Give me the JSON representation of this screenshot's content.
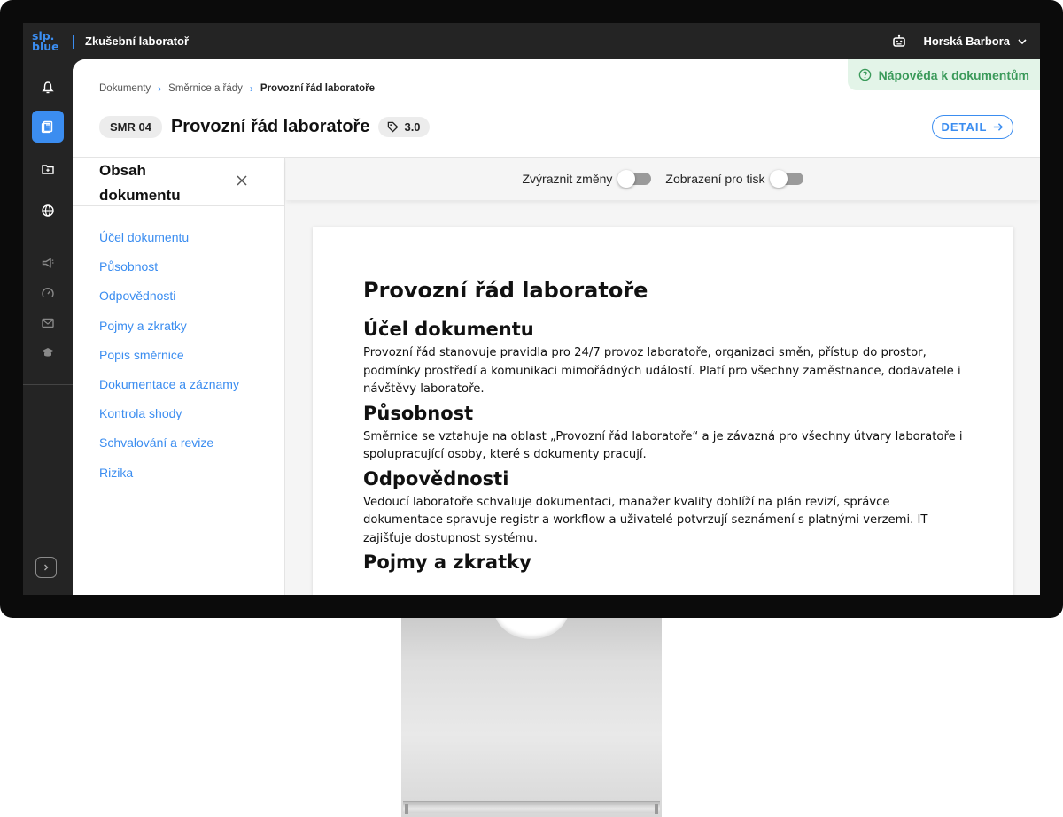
{
  "app": {
    "logo_line1": "slp.",
    "logo_line2": "blue",
    "title": "Zkušební laboratoř"
  },
  "user": {
    "name": "Horská Barbora"
  },
  "breadcrumb": {
    "items": [
      "Dokumenty",
      "Směrnice a řády"
    ],
    "current": "Provozní řád laboratoře"
  },
  "help": {
    "label": "Nápověda k dokumentům"
  },
  "document": {
    "code": "SMR 04",
    "title": "Provozní řád laboratoře",
    "version": "3.0",
    "detail_label": "DETAIL"
  },
  "toc": {
    "title": "Obsah dokumentu",
    "items": [
      "Účel dokumentu",
      "Působnost",
      "Odpovědnosti",
      "Pojmy a zkratky",
      "Popis směrnice",
      "Dokumentace a záznamy",
      "Kontrola shody",
      "Schvalování a revize",
      "Rizika"
    ]
  },
  "toolbar": {
    "highlight_changes_label": "Zvýraznit změny",
    "highlight_changes_on": false,
    "print_view_label": "Zobrazení pro tisk",
    "print_view_on": false
  },
  "content": {
    "heading": "Provozní řád laboratoře",
    "sections": [
      {
        "title": "Účel dokumentu",
        "text": "Provozní řád stanovuje pravidla pro 24/7 provoz laboratoře, organizaci směn, přístup do prostor, podmínky prostředí a komunikaci mimořádných událostí. Platí pro všechny zaměstnance, dodavatele i návštěvy laboratoře."
      },
      {
        "title": "Působnost",
        "text": "Směrnice se vztahuje na oblast „Provozní řád laboratoře“ a je závazná pro všechny útvary laboratoře i spolupracující osoby, které s dokumenty pracují."
      },
      {
        "title": "Odpovědnosti",
        "text": "Vedoucí laboratoře schvaluje dokumentaci, manažer kvality dohlíží na plán revizí, správce dokumentace spravuje registr a workflow a uživatelé potvrzují seznámení s platnými verzemi. IT zajišťuje dostupnost systému."
      },
      {
        "title": "Pojmy a zkratky",
        "text": ""
      }
    ]
  },
  "colors": {
    "accent": "#3b8df0",
    "help_bg": "#e3f4e8",
    "help_text": "#3b9a5a",
    "topbar": "#242424"
  }
}
